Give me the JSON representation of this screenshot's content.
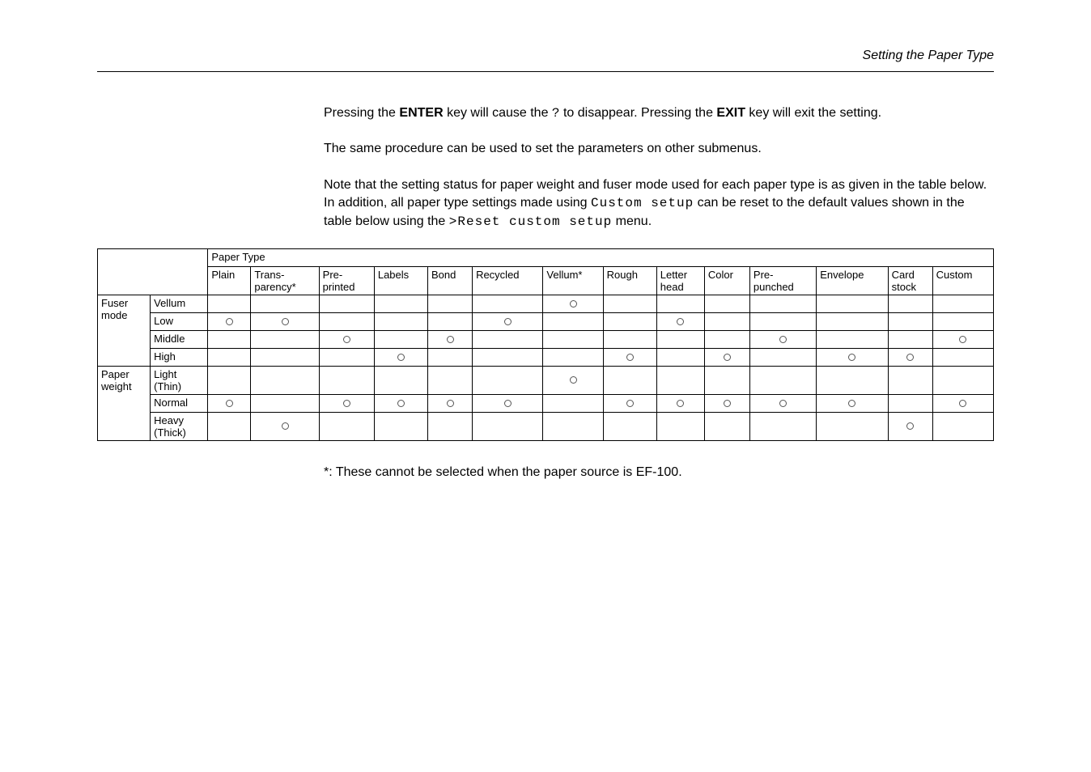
{
  "header_title": "Setting the Paper Type",
  "para1_pre": "Pressing the ",
  "para1_key1": "ENTER",
  "para1_mid1": " key will cause the ",
  "para1_q": "?",
  "para1_mid2": " to disappear. Pressing the ",
  "para1_key2": "EXIT",
  "para1_post": " key will exit the setting.",
  "para2": "The same procedure can be used to set the parameters on other submenus.",
  "para3_a": "Note that the setting status for paper weight and fuser mode used for each paper type is as given in the table below. In addition, all paper type settings made using ",
  "para3_mono1": "Custom setup",
  "para3_b": " can be reset to the default values shown in the table below using the ",
  "para3_mono2": ">Reset custom setup",
  "para3_c": " menu.",
  "footnote": "*: These cannot be selected when the paper source is EF-100.",
  "chart_data": {
    "type": "table",
    "title": "Paper Type",
    "row_group_labels": [
      "Fuser mode",
      "Paper weight"
    ],
    "row_labels": [
      [
        "Vellum",
        "Low",
        "Middle",
        "High"
      ],
      [
        "Light (Thin)",
        "Normal",
        "Heavy (Thick)"
      ]
    ],
    "columns": [
      "Plain",
      "Trans-parency*",
      "Pre-printed",
      "Labels",
      "Bond",
      "Recycled",
      "Vellum*",
      "Rough",
      "Letter head",
      "Color",
      "Pre-punched",
      "Envelope",
      "Card stock",
      "Custom"
    ],
    "marks": {
      "Fuser mode": {
        "Vellum": {
          "Vellum*": true
        },
        "Low": {
          "Plain": true,
          "Trans-parency*": true,
          "Recycled": true,
          "Letter head": true
        },
        "Middle": {
          "Pre-printed": true,
          "Bond": true,
          "Pre-punched": true,
          "Custom": true
        },
        "High": {
          "Labels": true,
          "Rough": true,
          "Color": true,
          "Envelope": true,
          "Card stock": true
        }
      },
      "Paper weight": {
        "Light (Thin)": {
          "Vellum*": true
        },
        "Normal": {
          "Plain": true,
          "Pre-printed": true,
          "Labels": true,
          "Bond": true,
          "Recycled": true,
          "Rough": true,
          "Letter head": true,
          "Color": true,
          "Pre-punched": true,
          "Envelope": true,
          "Custom": true
        },
        "Heavy (Thick)": {
          "Trans-parency*": true,
          "Card stock": true
        }
      }
    }
  },
  "cols": {
    "paper_type": "Paper Type",
    "plain": "Plain",
    "transparency_a": "Trans-",
    "transparency_b": "parency*",
    "preprinted_a": "Pre-",
    "preprinted_b": "printed",
    "labels": "Labels",
    "bond": "Bond",
    "recycled": "Recycled",
    "vellum_star": "Vellum*",
    "rough": "Rough",
    "letterhead_a": "Letter",
    "letterhead_b": "head",
    "color": "Color",
    "prepunched_a": "Pre-",
    "prepunched_b": "punched",
    "envelope": "Envelope",
    "cardstock_a": "Card",
    "cardstock_b": "stock",
    "custom": "Custom"
  },
  "rows": {
    "fuser_a": "Fuser",
    "fuser_b": "mode",
    "vellum": "Vellum",
    "low": "Low",
    "middle": "Middle",
    "high": "High",
    "paper_a": "Paper",
    "paper_b": "weight",
    "light_a": "Light",
    "light_b": "(Thin)",
    "normal": "Normal",
    "heavy_a": "Heavy",
    "heavy_b": "(Thick)"
  }
}
